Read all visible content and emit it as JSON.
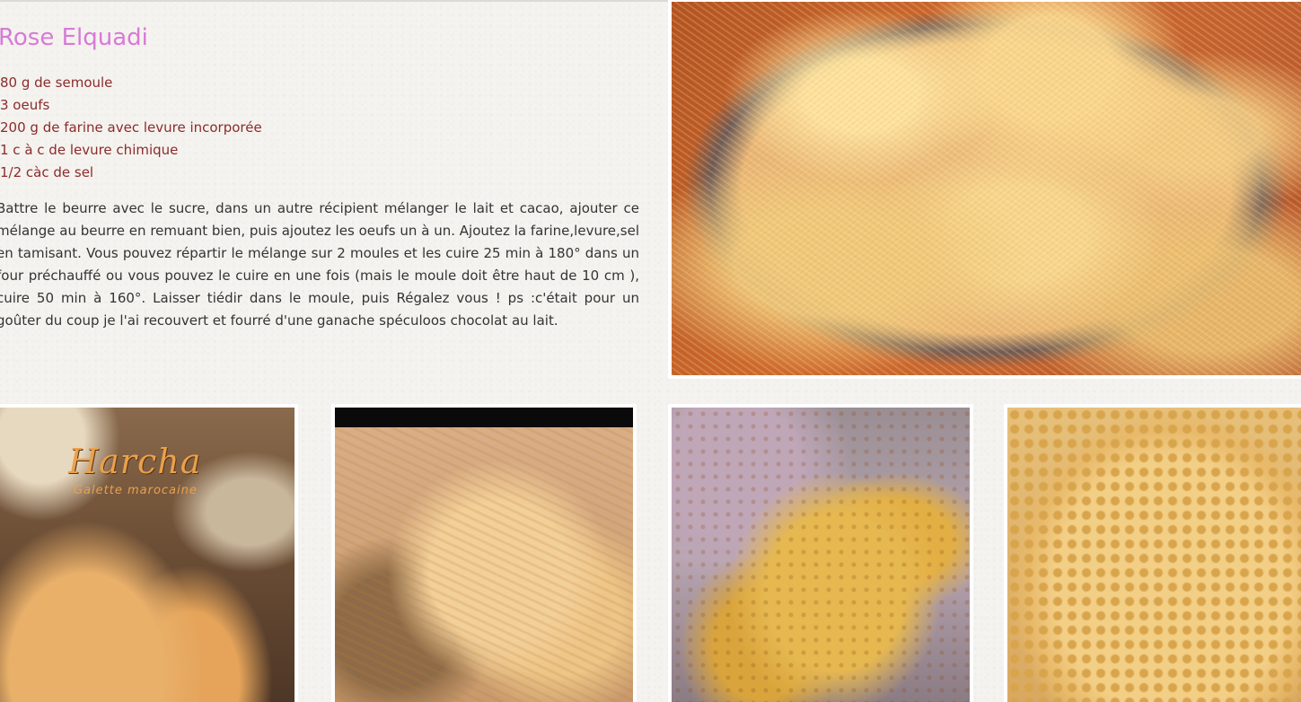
{
  "recipe": {
    "title": "Rose Elquadi",
    "ingredients": [
      "80 g de semoule",
      "3 oeufs",
      "200 g de farine avec levure incorporée",
      "1 c à c de levure chimique",
      "1/2 càc de sel"
    ],
    "instructions": "Battre le beurre avec le sucre, dans un autre récipient mélanger le lait et cacao, ajouter ce mélange au beurre en remuant bien, puis ajoutez les oeufs un à un. Ajoutez la farine,levure,sel en tamisant. Vous pouvez répartir le mélange sur 2 moules et les cuire 25 min à 180° dans un four préchauffé ou vous pouvez le cuire en une fois (mais le moule doit être haut de 10 cm ), cuire 50 min à 160°. Laisser tiédir dans le moule, puis Régalez vous ! ps :c'était pour un goûter du coup je l'ai recouvert et fourré d'une ganache spéculoos chocolat au lait."
  },
  "gallery": {
    "card1": {
      "brand": "Harcha",
      "subtitle": "Galette marocaine"
    }
  },
  "colors": {
    "title": "#d77ad6",
    "ingredients": "#8a2b2b",
    "body_text": "#333333"
  }
}
